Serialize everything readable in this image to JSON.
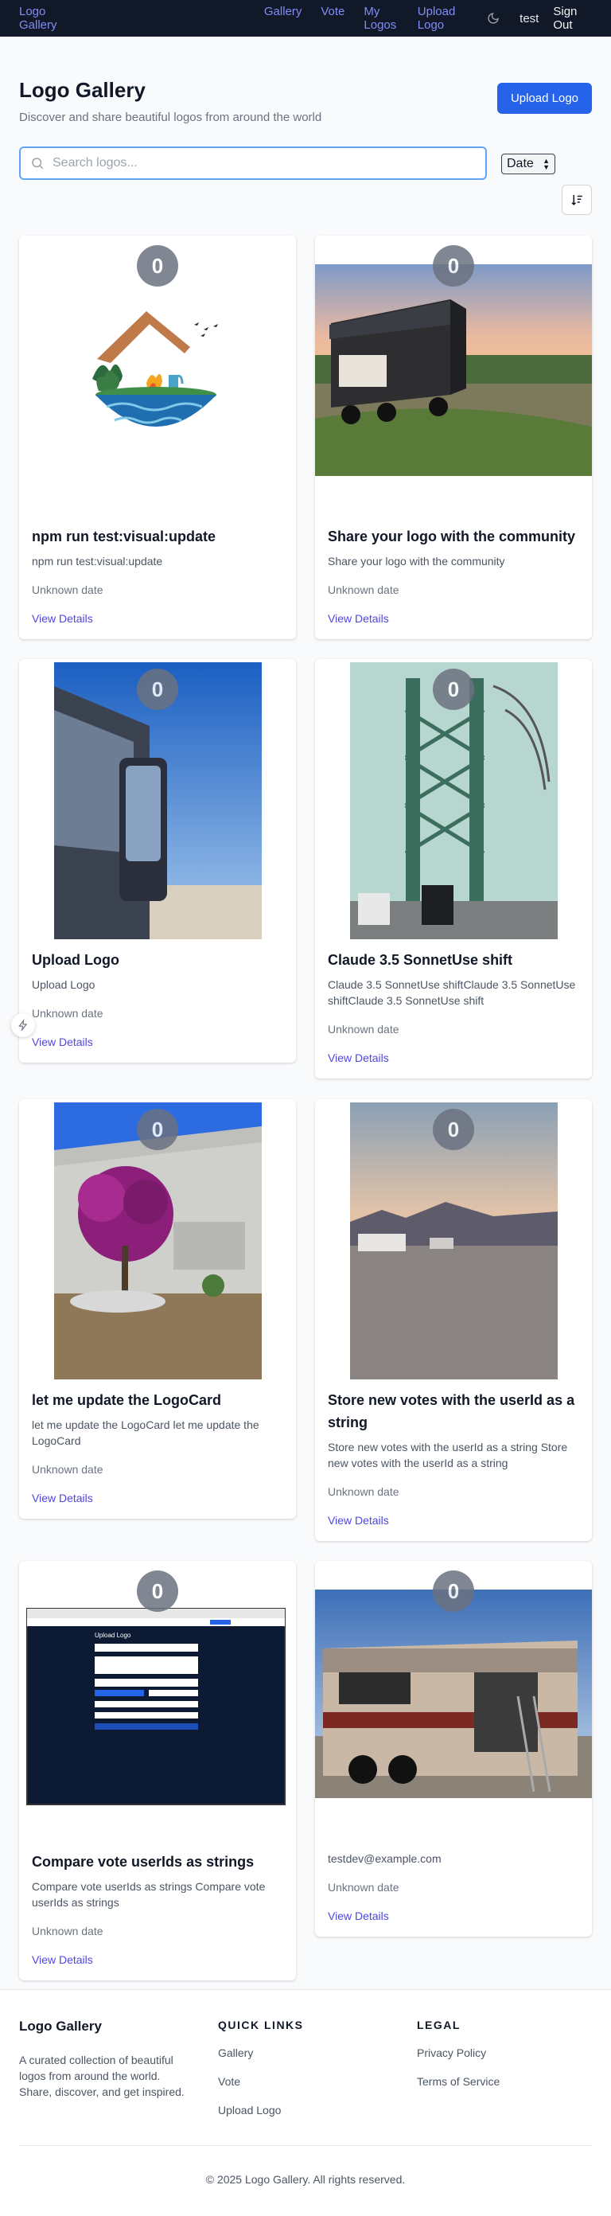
{
  "nav": {
    "brand": "Logo Gallery",
    "links": [
      "Gallery",
      "Vote",
      "My Logos",
      "Upload Logo"
    ],
    "user": "test",
    "signout": "Sign Out"
  },
  "header": {
    "title": "Logo Gallery",
    "subtitle": "Discover and share beautiful logos from around the world",
    "upload_button": "Upload Logo"
  },
  "search": {
    "placeholder": "Search logos...",
    "value": ""
  },
  "sort": {
    "selected": "Date"
  },
  "cards": [
    {
      "votes": "0",
      "title": "npm run test:visual:update",
      "description": "npm run test:visual:update",
      "date": "Unknown date",
      "link": "View Details",
      "image": "campfire-logo"
    },
    {
      "votes": "0",
      "title": "Share your logo with the community",
      "description": "Share your logo with the community",
      "date": "Unknown date",
      "link": "View Details",
      "image": "rv-sunset-photo"
    },
    {
      "votes": "0",
      "title": "Upload Logo",
      "description": "Upload Logo",
      "date": "Unknown date",
      "link": "View Details",
      "image": "rv-side-photo"
    },
    {
      "votes": "0",
      "title": "Claude 3.5 SonnetUse shift",
      "description": "Claude 3.5 SonnetUse shiftClaude 3.5 SonnetUse shiftClaude 3.5 SonnetUse shift",
      "date": "Unknown date",
      "link": "View Details",
      "image": "bridge-photo"
    },
    {
      "votes": "0",
      "title": "let me update the LogoCard",
      "description": "let me update the LogoCard let me update the LogoCard",
      "date": "Unknown date",
      "link": "View Details",
      "image": "flower-tree-photo"
    },
    {
      "votes": "0",
      "title": "Store new votes with the userId as a string",
      "description": "Store new votes with the userId as a string Store new votes with the userId as a string",
      "date": "Unknown date",
      "link": "View Details",
      "image": "desert-rv-photo"
    },
    {
      "votes": "0",
      "title": "Compare vote userIds as strings",
      "description": "Compare vote userIds as strings Compare vote userIds as strings",
      "date": "Unknown date",
      "link": "View Details",
      "image": "upload-form-screenshot"
    },
    {
      "votes": "0",
      "title": "",
      "description": "testdev@example.com",
      "date": "Unknown date",
      "link": "View Details",
      "image": "rv-repair-photo"
    }
  ],
  "screenshot_text": {
    "form_title": "Upload Logo"
  },
  "footer": {
    "brand": "Logo Gallery",
    "blurb": "A curated collection of beautiful logos from around the world. Share, discover, and get inspired.",
    "quick_links_heading": "QUICK LINKS",
    "quick_links": [
      "Gallery",
      "Vote",
      "Upload Logo"
    ],
    "legal_heading": "LEGAL",
    "legal_links": [
      "Privacy Policy",
      "Terms of Service"
    ],
    "copyright": "© 2025 Logo Gallery. All rights reserved."
  },
  "colors": {
    "nav_bg": "#111827",
    "nav_link": "#818cf8",
    "primary": "#2563eb",
    "link": "#4f46e5",
    "badge": "#6b7280"
  },
  "icons": [
    "search-icon",
    "moon-icon",
    "sort-direction-icon",
    "sparkle-icon"
  ]
}
